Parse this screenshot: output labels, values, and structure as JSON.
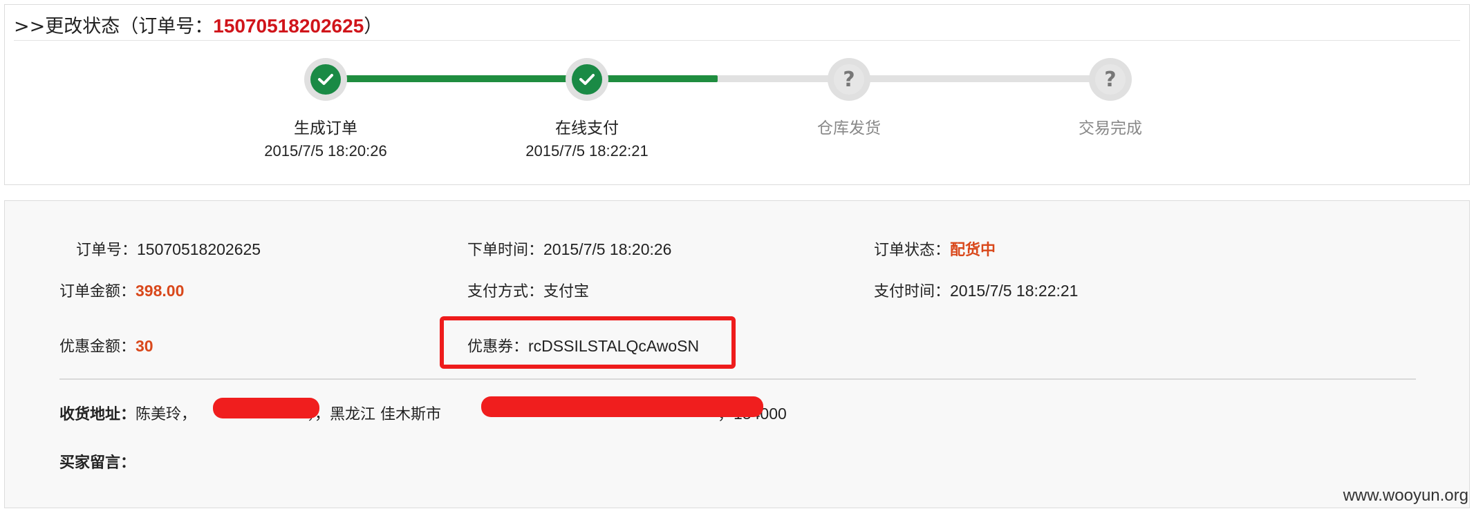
{
  "header": {
    "prefix": ">>更改状态（订单号：",
    "order_no": "15070518202625",
    "suffix": "）"
  },
  "progress": {
    "steps": [
      {
        "label": "生成订单",
        "time": "2015/7/5 18:20:26",
        "status": "done"
      },
      {
        "label": "在线支付",
        "time": "2015/7/5 18:22:21",
        "status": "done"
      },
      {
        "label": "仓库发货",
        "time": "",
        "status": "pending"
      },
      {
        "label": "交易完成",
        "time": "",
        "status": "pending"
      }
    ],
    "pending_symbol": "?"
  },
  "details": {
    "order_no_label": "订单号：",
    "order_no_value": "15070518202625",
    "order_time_label": "下单时间：",
    "order_time_value": "2015/7/5 18:20:26",
    "order_status_label": "订单状态：",
    "order_status_value": "配货中",
    "amount_label": "订单金额：",
    "amount_value": "398.00",
    "pay_method_label": "支付方式：",
    "pay_method_value": "支付宝",
    "pay_time_label": "支付时间：",
    "pay_time_value": "2015/7/5 18:22:21",
    "discount_label": "优惠金额：",
    "discount_value": "30",
    "coupon_label": "优惠券：",
    "coupon_value": "rcDSSILSTALQcAwoSN",
    "address_label": "收货地址：",
    "address_name": "陈美玲，",
    "address_mid": "，，黑龙江 佳木斯市",
    "address_zip": "，154000",
    "message_label": "买家留言："
  },
  "watermark": "www.wooyun.org",
  "colors": {
    "accent_red": "#d0141a",
    "orange": "#d9481b",
    "green": "#1a8a45",
    "highlight_red": "#ee1c1c"
  }
}
